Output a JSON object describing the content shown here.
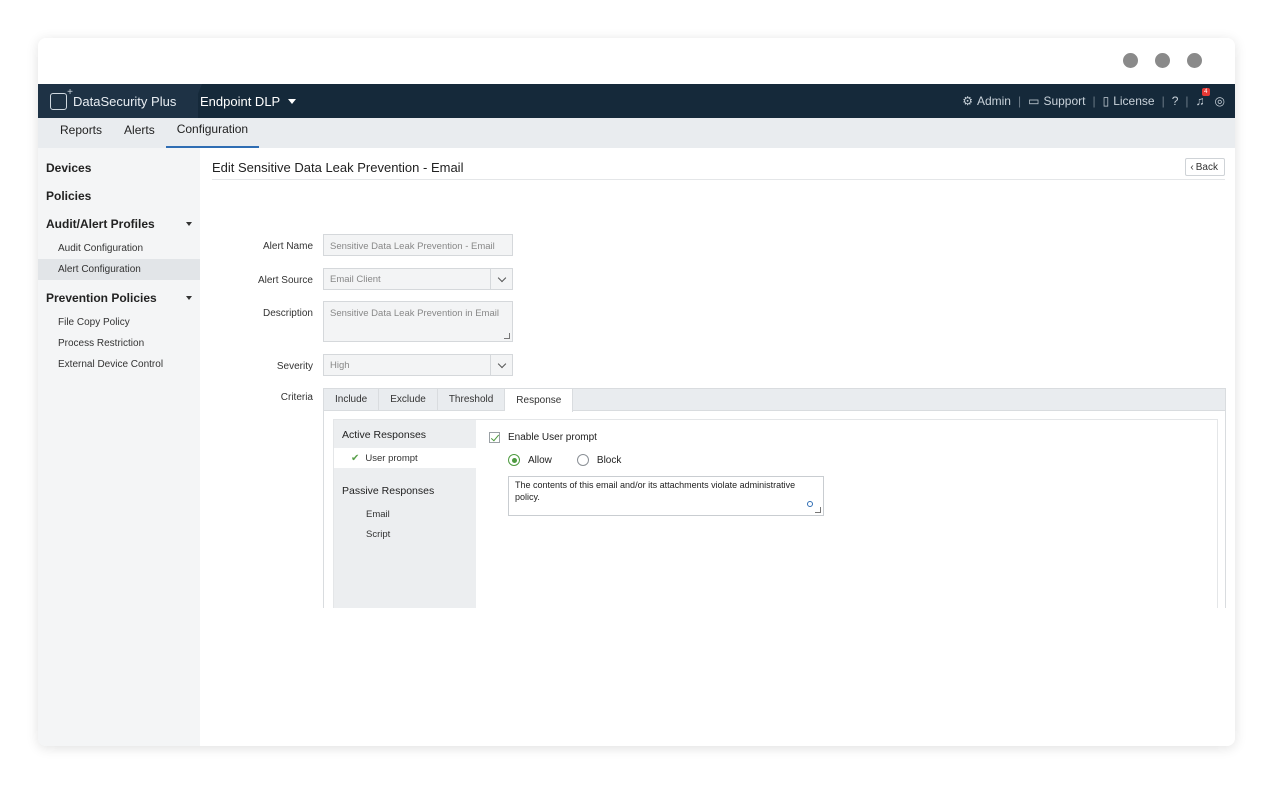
{
  "app": {
    "brand": "DataSecurity Plus",
    "product": "Endpoint DLP",
    "top_links": {
      "admin": "Admin",
      "support": "Support",
      "license": "License",
      "help": "?"
    },
    "notification_count": "4"
  },
  "subnav": {
    "reports": "Reports",
    "alerts": "Alerts",
    "configuration": "Configuration"
  },
  "sidebar": {
    "devices": "Devices",
    "policies": "Policies",
    "audit_alert_profiles": "Audit/Alert Profiles",
    "audit_configuration": "Audit Configuration",
    "alert_configuration": "Alert Configuration",
    "prevention_policies": "Prevention Policies",
    "file_copy_policy": "File Copy Policy",
    "process_restriction": "Process Restriction",
    "external_device_control": "External Device Control"
  },
  "page": {
    "title": "Edit Sensitive Data Leak Prevention - Email",
    "back_label": "Back"
  },
  "form": {
    "alert_name_label": "Alert Name",
    "alert_name_value": "Sensitive Data Leak Prevention - Email",
    "alert_source_label": "Alert Source",
    "alert_source_value": "Email Client",
    "description_label": "Description",
    "description_value": "Sensitive Data Leak Prevention in Email",
    "severity_label": "Severity",
    "severity_value": "High",
    "criteria_label": "Criteria"
  },
  "criteria": {
    "tabs": {
      "include": "Include",
      "exclude": "Exclude",
      "threshold": "Threshold",
      "response": "Response"
    },
    "active_responses": "Active Responses",
    "user_prompt": "User prompt",
    "passive_responses": "Passive Responses",
    "email": "Email",
    "script": "Script",
    "enable_user_prompt": "Enable User prompt",
    "allow": "Allow",
    "block": "Block",
    "message": "The contents of this email and/or its attachments violate administrative policy."
  }
}
